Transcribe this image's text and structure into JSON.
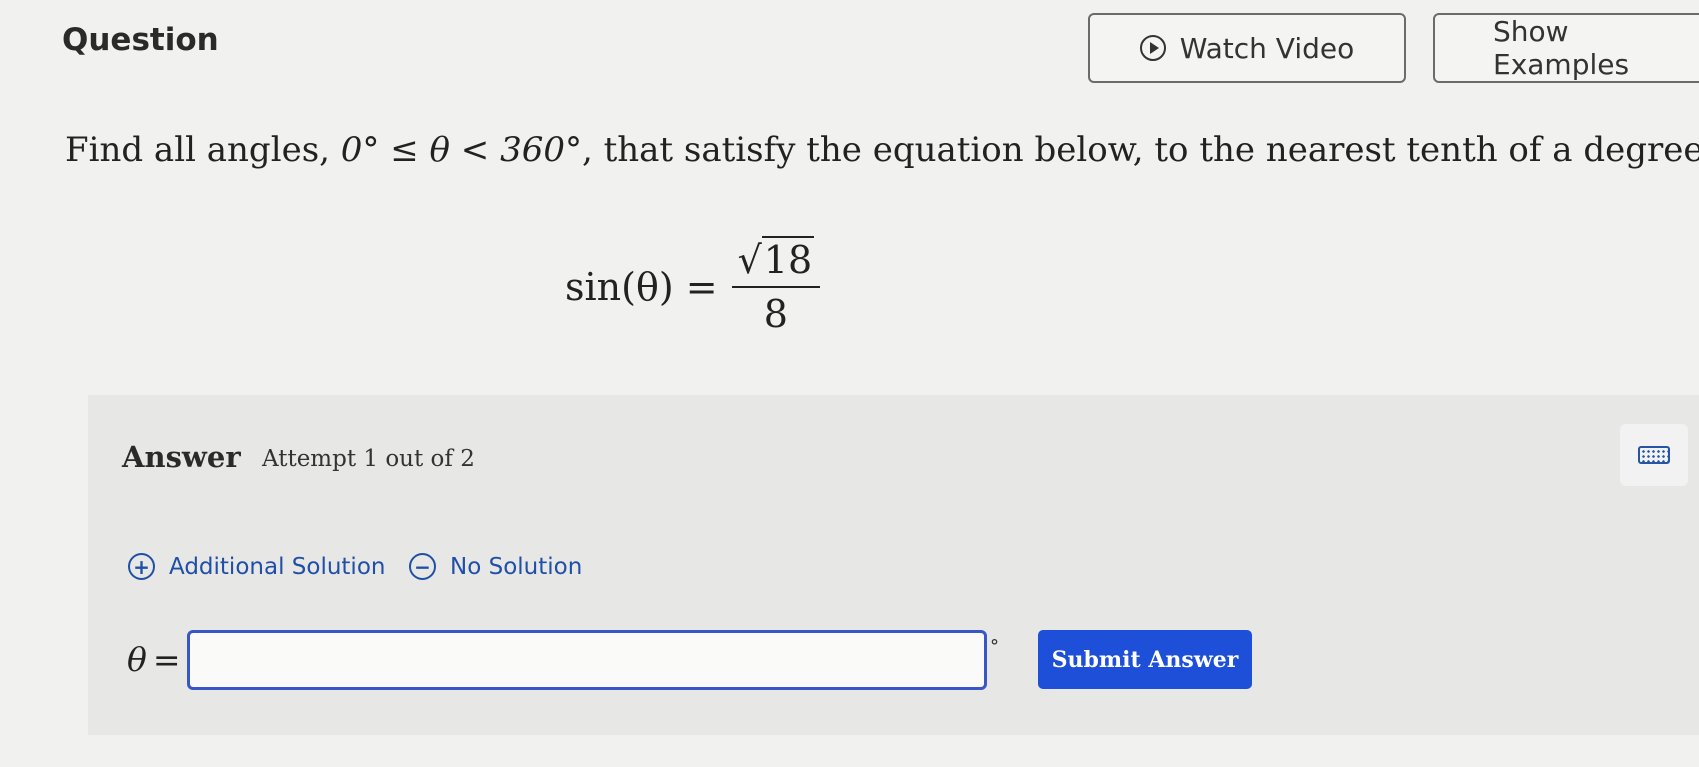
{
  "question": {
    "title": "Question",
    "watch_video_label": "Watch Video",
    "show_examples_label": "Show Examples",
    "prompt": {
      "before": "Find all angles, ",
      "math": "0° ≤ θ < 360°",
      "after": ", that satisfy the equation below, to the nearest tenth of a degree."
    },
    "equation": {
      "lhs": "sin(θ) =",
      "radical_symbol": "√",
      "radicand": "18",
      "denominator": "8"
    }
  },
  "answer": {
    "label": "Answer",
    "attempt_text": "Attempt 1 out of 2",
    "additional_solution_label": "Additional Solution",
    "no_solution_label": "No Solution",
    "add_icon_glyph": "+",
    "remove_icon_glyph": "−",
    "variable": "θ",
    "equals": "=",
    "input_value": "",
    "degree_symbol": "°",
    "submit_label": "Submit Answer"
  },
  "icons": {
    "watch_video": "play-circle-icon",
    "keyboard": "keyboard-icon",
    "additional_solution": "plus-circle-icon",
    "no_solution": "minus-circle-icon"
  },
  "colors": {
    "accent_blue": "#1d4fd8",
    "link_blue": "#1f4fa8",
    "input_border": "#3857c4",
    "panel_bg": "#e7e7e5"
  }
}
